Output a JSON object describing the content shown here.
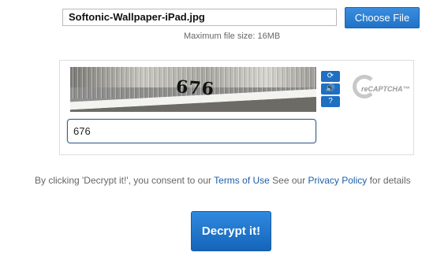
{
  "upload": {
    "file_name": "Softonic-Wallpaper-iPad.jpg",
    "choose_button": "Choose File",
    "max_size": "Maximum file size: 16MB"
  },
  "captcha": {
    "image_text": "676",
    "input_value": "676",
    "logo_text": "reCAPTCHA™",
    "buttons": [
      {
        "icon": "refresh-icon",
        "glyph": "⟳"
      },
      {
        "icon": "audio-icon",
        "glyph": "🔊"
      },
      {
        "icon": "help-icon",
        "glyph": "?"
      }
    ]
  },
  "consent": {
    "prefix": "By clicking 'Decrypt it!', you consent to our",
    "terms_link": "Terms of Use",
    "middle": "See our",
    "privacy_link": "Privacy Policy",
    "suffix": "for details"
  },
  "actions": {
    "decrypt_button": "Decrypt it!"
  },
  "colors": {
    "accent": "#1f72c6",
    "link": "#1b5fa8"
  }
}
